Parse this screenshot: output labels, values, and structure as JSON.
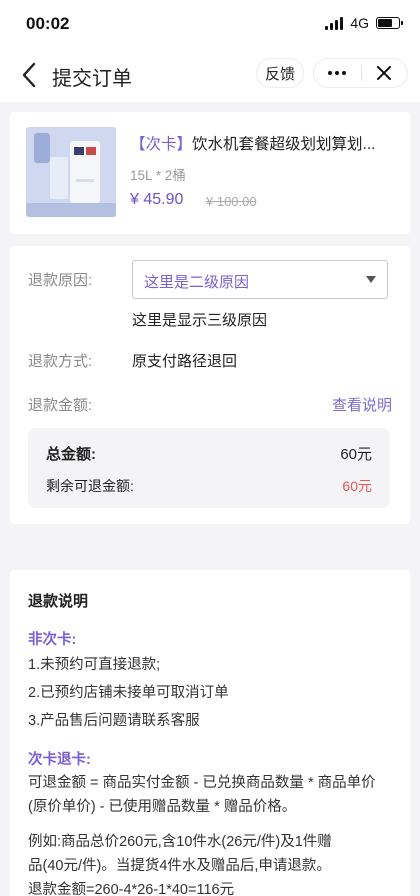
{
  "status_bar": {
    "time": "00:02",
    "network": "4G",
    "battery_level": 0.7
  },
  "nav": {
    "title": "提交订单",
    "feedback_label": "反馈"
  },
  "product": {
    "tag": "【次卡】",
    "name": "饮水机套餐超级划划算划...",
    "spec": "15L * 2桶",
    "price": "¥ 45.90",
    "original_price": "¥ 100.00"
  },
  "refund_form": {
    "reason_label": "退款原因:",
    "reason_value": "这里是二级原因",
    "reason_level3": "这里是显示三级原因",
    "method_label": "退款方式:",
    "method_value": "原支付路径退回",
    "amount_label": "退款金额:",
    "view_explain_link": "查看说明",
    "total_label": "总金额:",
    "total_value": "60元",
    "remaining_label": "剩余可退金额:",
    "remaining_value": "60元"
  },
  "explanation": {
    "title": "退款说明",
    "non_card_title": "非次卡:",
    "non_card_items": [
      "1.未预约可直接退款;",
      "2.已预约店铺未接单可取消订单",
      "3.产品售后问题请联系客服"
    ],
    "card_title": "次卡退卡:",
    "formula_line1": "可退金额 = 商品实付金额 - 已兑换商品数量 * 商品单价",
    "formula_line2": "(原价单价) - 已使用赠品数量 * 赠品价格。",
    "example_line1": "例如:商品总价260元,含10件水(26元/件)及1件赠",
    "example_line2": "品(40元/件)。当提货4件水及赠品后,申请退款。",
    "example_line3": "退款金额=260-4*26-1*40=116元"
  },
  "colors": {
    "accent": "#7a5fd6",
    "price": "#6b52c8",
    "alert": "#e35a5a",
    "background": "#f4f4f6"
  }
}
